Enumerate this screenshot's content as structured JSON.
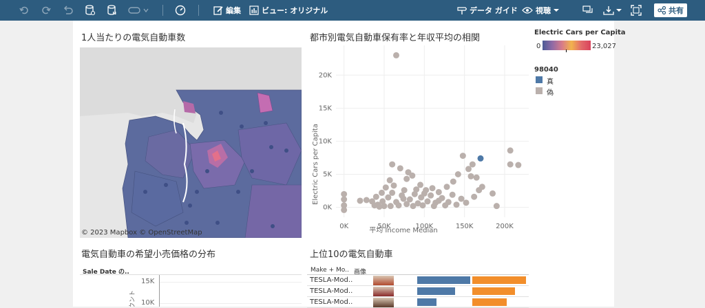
{
  "toolbar": {
    "edit_label": "編集",
    "view_label": "ビュー: オリジナル",
    "data_guide_label": "データ ガイド",
    "watch_label": "視聴",
    "share_label": "共有"
  },
  "map_panel": {
    "title": "1人当たりの電気自動車数",
    "attribution": "© 2023 Mapbox  © OpenStreetMap"
  },
  "scatter_panel": {
    "title": "都市別電気自動車保有率と年収平均の相関"
  },
  "legend": {
    "color_title": "Electric Cars per Capita",
    "color_min": "0",
    "color_max": "23,027",
    "group_title": "98040",
    "group_true": "真",
    "group_false": "偽",
    "colors": {
      "true": "#4e79a7",
      "false": "#bab0ac"
    }
  },
  "histogram_panel": {
    "title": "電気自動車の希望小売価格の分布",
    "filter_label": "Sale Date の..",
    "ylabel": "カウント",
    "y_ticks": [
      "15K",
      "10K"
    ]
  },
  "top10_panel": {
    "title": "上位10の電気自動車",
    "col_make": "Make + Mo..",
    "col_image": "画像",
    "rows": [
      {
        "label": "TESLA-Mod..",
        "blue": 1.0,
        "orange": 1.0
      },
      {
        "label": "TESLA-Mod..",
        "blue": 0.71,
        "orange": 0.8
      },
      {
        "label": "TESLA-Mod..",
        "blue": 0.37,
        "orange": 0.64
      }
    ]
  },
  "chart_data": {
    "type": "scatter",
    "title": "都市別電気自動車保有率と年収平均の相関",
    "xlabel": "平均 Income Median",
    "ylabel": "Electric Cars per Capita",
    "xlim": [
      -10000,
      230000
    ],
    "ylim": [
      -1500,
      24500
    ],
    "x_ticks": [
      "0K",
      "50K",
      "100K",
      "150K",
      "200K"
    ],
    "x_tick_values": [
      0,
      50000,
      100000,
      150000,
      200000
    ],
    "y_ticks": [
      "0K",
      "5K",
      "10K",
      "15K",
      "20K"
    ],
    "y_tick_values": [
      0,
      5000,
      10000,
      15000,
      20000
    ],
    "series": [
      {
        "name": "真",
        "points": [
          [
            170000,
            7400
          ]
        ]
      },
      {
        "name": "偽",
        "points": [
          [
            65000,
            23000
          ],
          [
            207000,
            8600
          ],
          [
            207000,
            6500
          ],
          [
            217000,
            6400
          ],
          [
            148000,
            7800
          ],
          [
            160000,
            6500
          ],
          [
            155000,
            5800
          ],
          [
            158000,
            4700
          ],
          [
            165000,
            4500
          ],
          [
            172000,
            3100
          ],
          [
            185000,
            2100
          ],
          [
            190000,
            200
          ],
          [
            142000,
            5000
          ],
          [
            136000,
            3900
          ],
          [
            128000,
            3100
          ],
          [
            118000,
            2300
          ],
          [
            110000,
            2900
          ],
          [
            100000,
            2100
          ],
          [
            95000,
            3400
          ],
          [
            85000,
            4800
          ],
          [
            80000,
            5300
          ],
          [
            78000,
            4300
          ],
          [
            70000,
            5900
          ],
          [
            60000,
            6500
          ],
          [
            57000,
            4100
          ],
          [
            62000,
            3300
          ],
          [
            52000,
            3000
          ],
          [
            47000,
            2200
          ],
          [
            40000,
            1600
          ],
          [
            35000,
            900
          ],
          [
            28000,
            1100
          ],
          [
            20000,
            1000
          ],
          [
            0,
            2000
          ],
          [
            0,
            1200
          ],
          [
            0,
            300
          ],
          [
            0,
            -400
          ],
          [
            42000,
            400
          ],
          [
            48000,
            900
          ],
          [
            55000,
            1500
          ],
          [
            60000,
            2200
          ],
          [
            65000,
            800
          ],
          [
            72000,
            1800
          ],
          [
            75000,
            2600
          ],
          [
            82000,
            1200
          ],
          [
            88000,
            2000
          ],
          [
            92000,
            600
          ],
          [
            96000,
            1500
          ],
          [
            104000,
            900
          ],
          [
            108000,
            1800
          ],
          [
            114000,
            700
          ],
          [
            122000,
            1400
          ],
          [
            130000,
            800
          ],
          [
            135000,
            1900
          ],
          [
            140000,
            400
          ],
          [
            146000,
            1300
          ],
          [
            152000,
            700
          ],
          [
            162000,
            1600
          ],
          [
            168000,
            2600
          ],
          [
            58000,
            200
          ],
          [
            68000,
            300
          ],
          [
            78000,
            500
          ],
          [
            86000,
            200
          ],
          [
            98000,
            300
          ],
          [
            112000,
            200
          ],
          [
            126000,
            300
          ],
          [
            50000,
            200
          ],
          [
            44000,
            100
          ],
          [
            38000,
            300
          ],
          [
            74000,
            1300
          ],
          [
            90000,
            2700
          ],
          [
            102000,
            2600
          ],
          [
            118000,
            1000
          ]
        ]
      }
    ],
    "legend": "right"
  }
}
